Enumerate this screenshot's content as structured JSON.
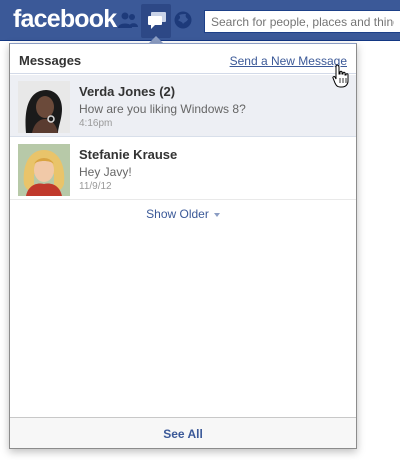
{
  "header": {
    "logo_text": "facebook",
    "search_placeholder": "Search for people, places and things",
    "icons": [
      "friends-icon",
      "messages-icon",
      "notifications-icon"
    ]
  },
  "messages_panel": {
    "title": "Messages",
    "new_message_link": "Send a New Message",
    "items": [
      {
        "sender": "Verda Jones (2)",
        "snippet": "How are you liking Windows 8?",
        "time": "4:16pm",
        "unread": true
      },
      {
        "sender": "Stefanie Krause",
        "snippet": "Hey Javy!",
        "time": "11/9/12",
        "unread": false
      }
    ],
    "show_older": "Show Older",
    "see_all": "See All"
  },
  "colors": {
    "brand_blue": "#3b5998",
    "unread_bg": "#edeff4",
    "link": "#3b5998"
  }
}
